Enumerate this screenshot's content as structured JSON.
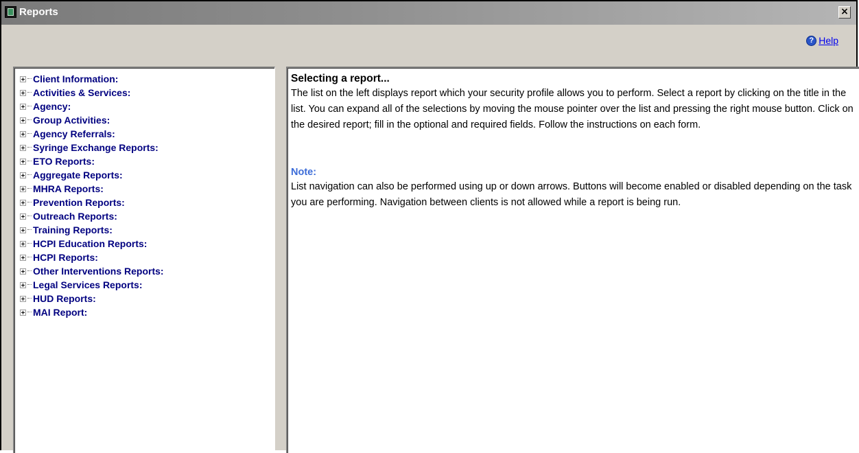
{
  "window": {
    "title": "Reports",
    "close_glyph": "×"
  },
  "help": {
    "icon_glyph": "?",
    "label": "Help"
  },
  "tree": {
    "items": [
      {
        "label": "Client Information:"
      },
      {
        "label": "Activities & Services:"
      },
      {
        "label": "Agency:"
      },
      {
        "label": "Group Activities:"
      },
      {
        "label": "Agency Referrals:"
      },
      {
        "label": "Syringe Exchange Reports:"
      },
      {
        "label": "ETO Reports:"
      },
      {
        "label": "Aggregate Reports:"
      },
      {
        "label": "MHRA Reports:"
      },
      {
        "label": "Prevention Reports:"
      },
      {
        "label": "Outreach Reports:"
      },
      {
        "label": "Training Reports:"
      },
      {
        "label": "HCPI Education Reports:"
      },
      {
        "label": "HCPI Reports:"
      },
      {
        "label": "Other Interventions Reports:"
      },
      {
        "label": "Legal Services Reports:"
      },
      {
        "label": "HUD Reports:"
      },
      {
        "label": "MAI Report:"
      }
    ]
  },
  "info": {
    "heading": "Selecting a report...",
    "body": "The list on the left displays report which your security profile allows you to perform.  Select a report by clicking on the title in the list.  You can expand all of the selections by moving the mouse pointer over the list and pressing the right mouse button.  Click on the desired report; fill in the optional and required fields.  Follow the instructions on each form.",
    "note_label": "Note:",
    "note_body": "List navigation can also be performed using up or down arrows.  Buttons will become enabled or disabled depending on the task you are performing. Navigation between clients is not allowed while a report is being run."
  },
  "colors": {
    "tree_label": "#000080",
    "note_label": "#3c6cd8",
    "link": "#0000ee",
    "window_bg": "#d4d0c8"
  },
  "icons": {
    "window": "reports-window-icon",
    "close": "close-icon",
    "help": "help-icon",
    "tree_expander": "plus-box-icon"
  }
}
